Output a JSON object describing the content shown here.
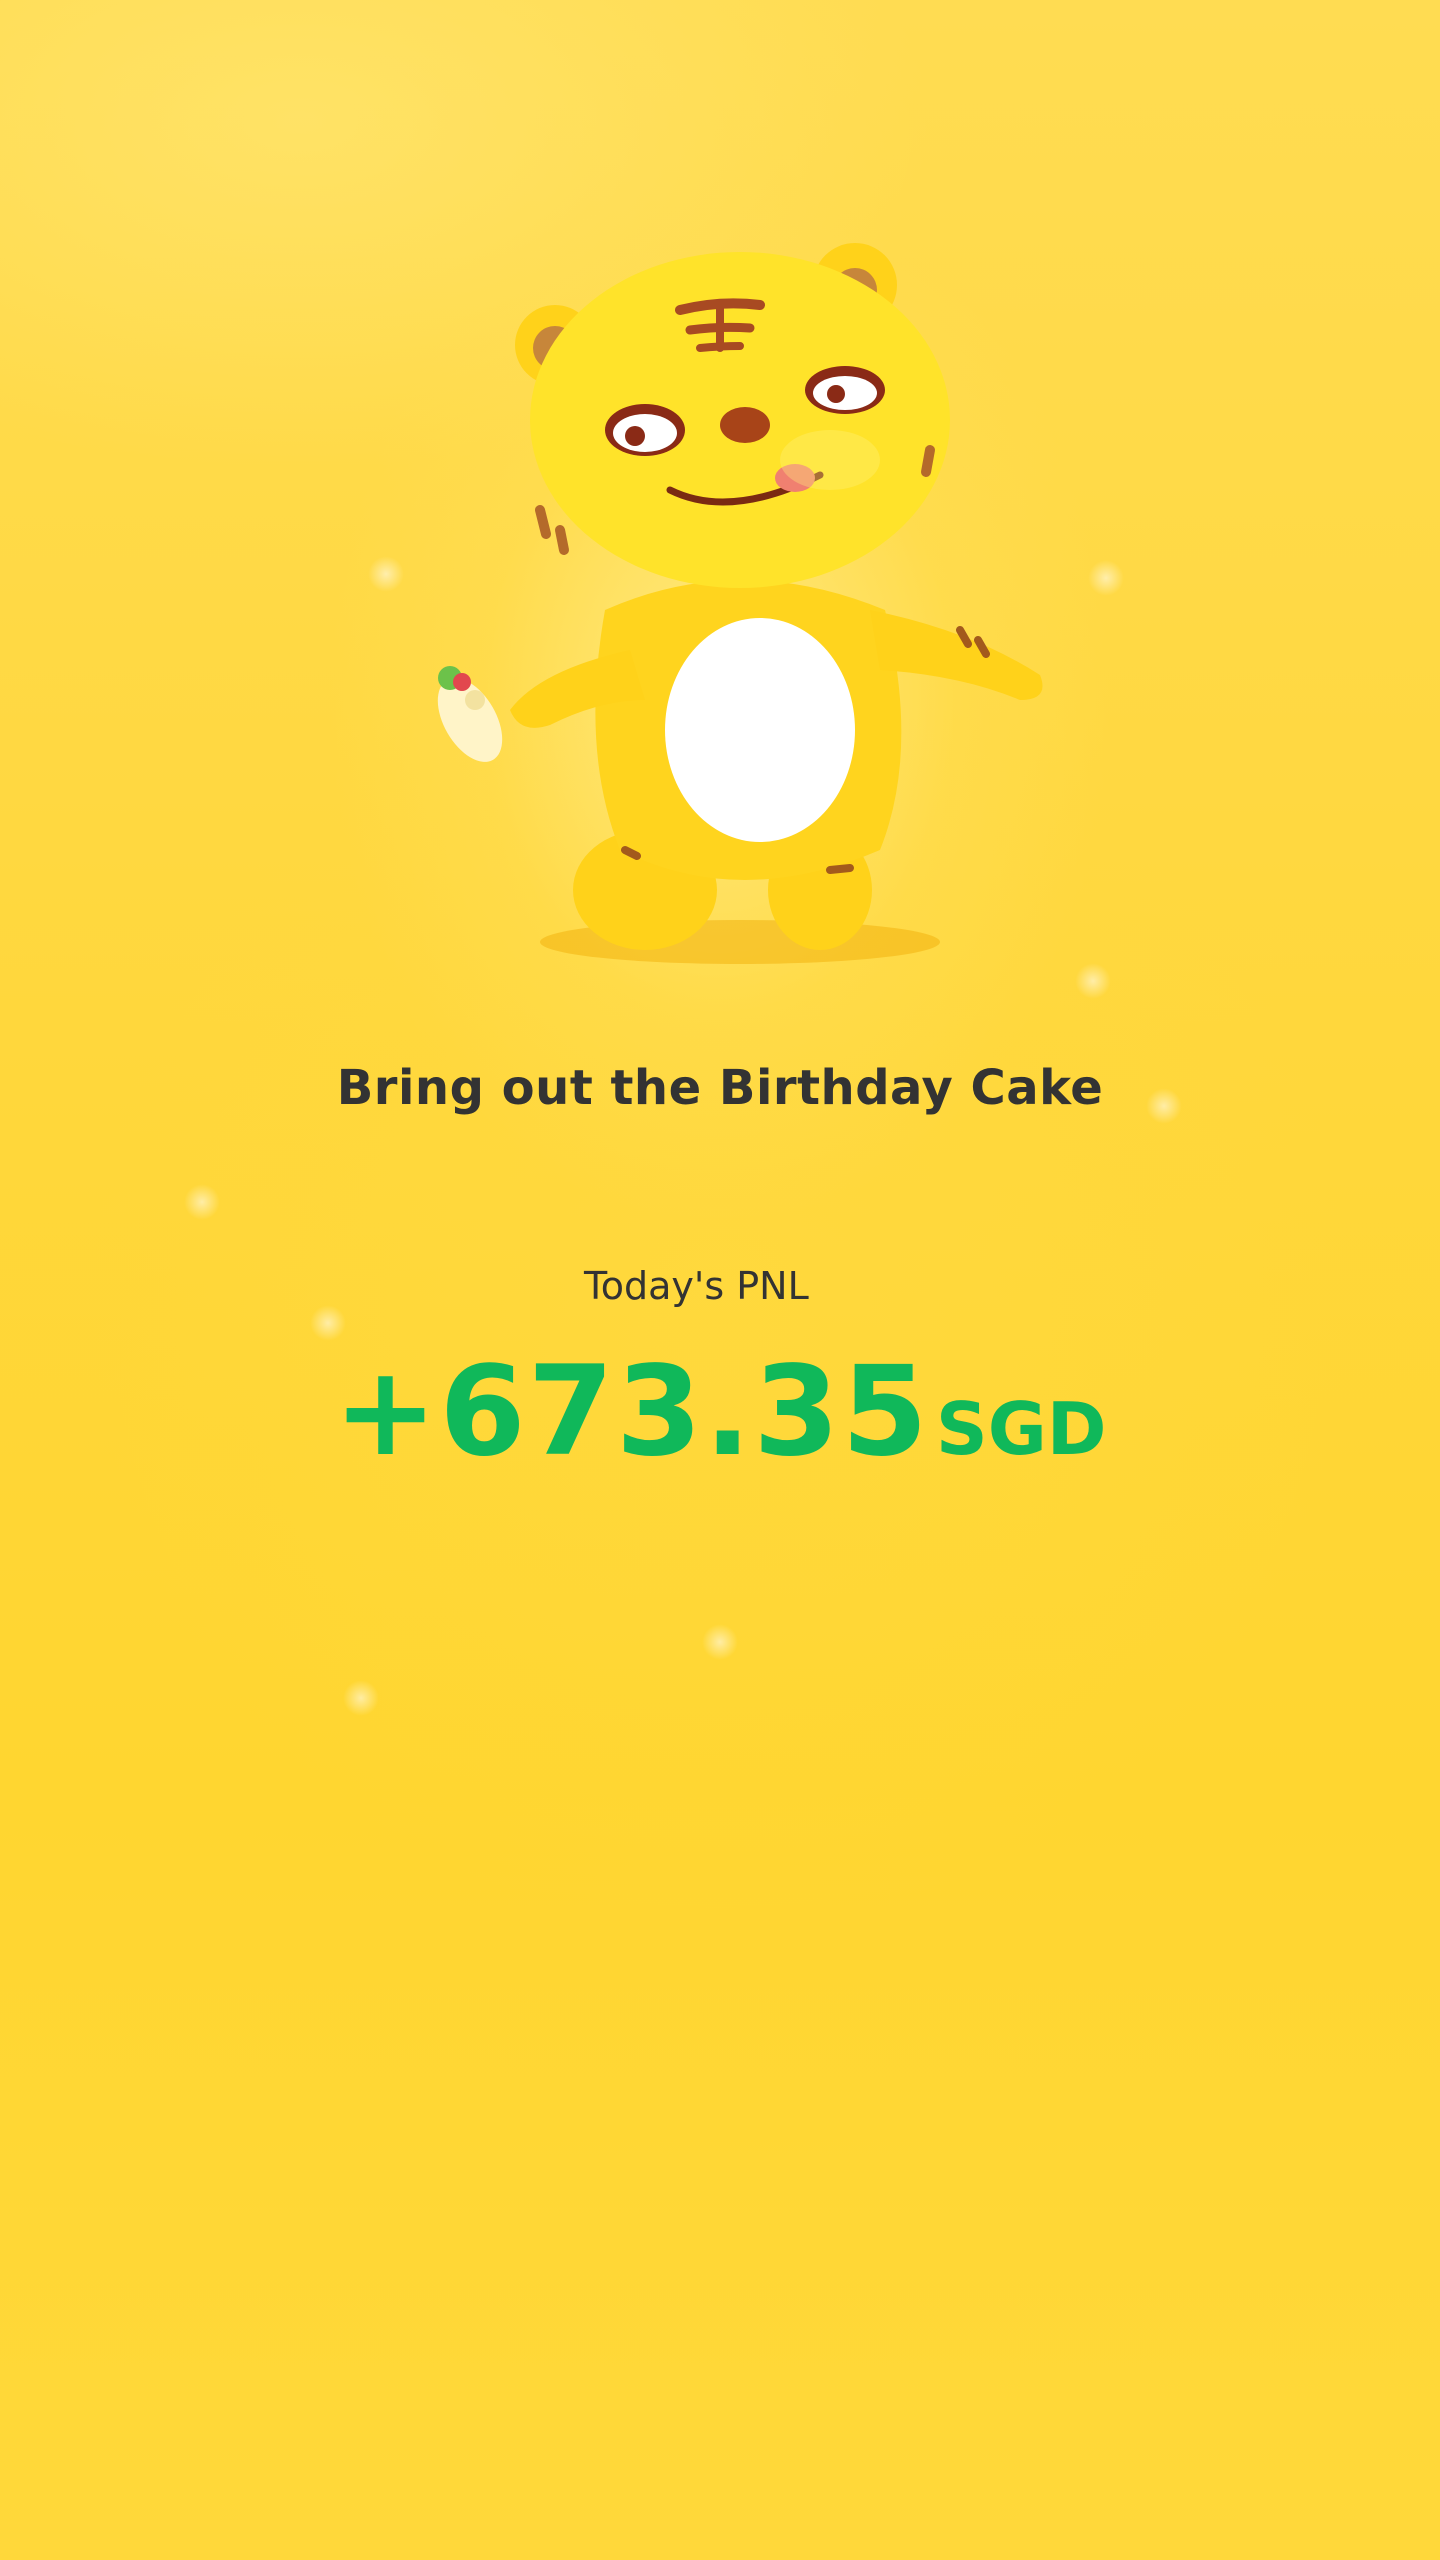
{
  "celebration": {
    "title": "Bring out the Birthday Cake",
    "mascot_icon": "tiger-mascot-icon"
  },
  "pnl": {
    "label": "Today's PNL",
    "amount": "+673.35",
    "currency": "SGD",
    "color": "#10b85a"
  },
  "colors": {
    "background": "#ffd83a",
    "text": "#333333"
  }
}
